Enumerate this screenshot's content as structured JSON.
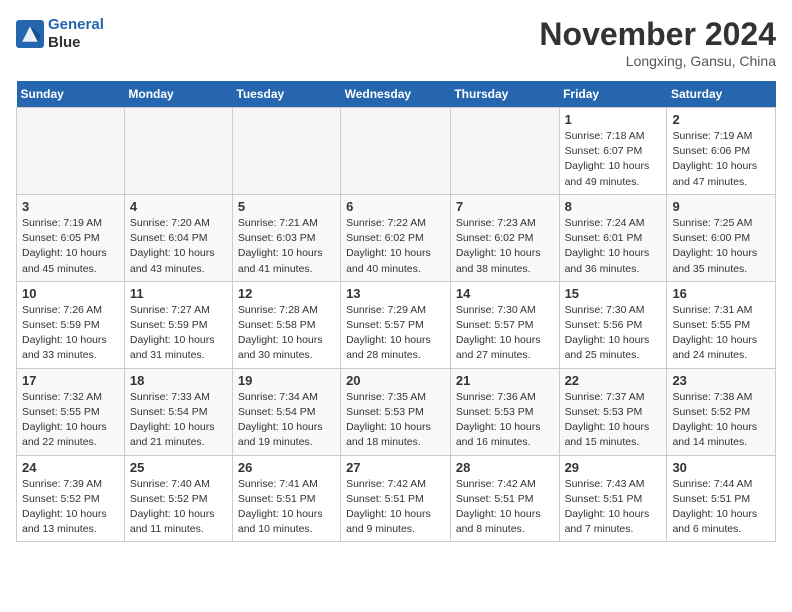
{
  "header": {
    "logo_line1": "General",
    "logo_line2": "Blue",
    "month": "November 2024",
    "location": "Longxing, Gansu, China"
  },
  "weekdays": [
    "Sunday",
    "Monday",
    "Tuesday",
    "Wednesday",
    "Thursday",
    "Friday",
    "Saturday"
  ],
  "weeks": [
    [
      {
        "day": "",
        "info": ""
      },
      {
        "day": "",
        "info": ""
      },
      {
        "day": "",
        "info": ""
      },
      {
        "day": "",
        "info": ""
      },
      {
        "day": "",
        "info": ""
      },
      {
        "day": "1",
        "info": "Sunrise: 7:18 AM\nSunset: 6:07 PM\nDaylight: 10 hours\nand 49 minutes."
      },
      {
        "day": "2",
        "info": "Sunrise: 7:19 AM\nSunset: 6:06 PM\nDaylight: 10 hours\nand 47 minutes."
      }
    ],
    [
      {
        "day": "3",
        "info": "Sunrise: 7:19 AM\nSunset: 6:05 PM\nDaylight: 10 hours\nand 45 minutes."
      },
      {
        "day": "4",
        "info": "Sunrise: 7:20 AM\nSunset: 6:04 PM\nDaylight: 10 hours\nand 43 minutes."
      },
      {
        "day": "5",
        "info": "Sunrise: 7:21 AM\nSunset: 6:03 PM\nDaylight: 10 hours\nand 41 minutes."
      },
      {
        "day": "6",
        "info": "Sunrise: 7:22 AM\nSunset: 6:02 PM\nDaylight: 10 hours\nand 40 minutes."
      },
      {
        "day": "7",
        "info": "Sunrise: 7:23 AM\nSunset: 6:02 PM\nDaylight: 10 hours\nand 38 minutes."
      },
      {
        "day": "8",
        "info": "Sunrise: 7:24 AM\nSunset: 6:01 PM\nDaylight: 10 hours\nand 36 minutes."
      },
      {
        "day": "9",
        "info": "Sunrise: 7:25 AM\nSunset: 6:00 PM\nDaylight: 10 hours\nand 35 minutes."
      }
    ],
    [
      {
        "day": "10",
        "info": "Sunrise: 7:26 AM\nSunset: 5:59 PM\nDaylight: 10 hours\nand 33 minutes."
      },
      {
        "day": "11",
        "info": "Sunrise: 7:27 AM\nSunset: 5:59 PM\nDaylight: 10 hours\nand 31 minutes."
      },
      {
        "day": "12",
        "info": "Sunrise: 7:28 AM\nSunset: 5:58 PM\nDaylight: 10 hours\nand 30 minutes."
      },
      {
        "day": "13",
        "info": "Sunrise: 7:29 AM\nSunset: 5:57 PM\nDaylight: 10 hours\nand 28 minutes."
      },
      {
        "day": "14",
        "info": "Sunrise: 7:30 AM\nSunset: 5:57 PM\nDaylight: 10 hours\nand 27 minutes."
      },
      {
        "day": "15",
        "info": "Sunrise: 7:30 AM\nSunset: 5:56 PM\nDaylight: 10 hours\nand 25 minutes."
      },
      {
        "day": "16",
        "info": "Sunrise: 7:31 AM\nSunset: 5:55 PM\nDaylight: 10 hours\nand 24 minutes."
      }
    ],
    [
      {
        "day": "17",
        "info": "Sunrise: 7:32 AM\nSunset: 5:55 PM\nDaylight: 10 hours\nand 22 minutes."
      },
      {
        "day": "18",
        "info": "Sunrise: 7:33 AM\nSunset: 5:54 PM\nDaylight: 10 hours\nand 21 minutes."
      },
      {
        "day": "19",
        "info": "Sunrise: 7:34 AM\nSunset: 5:54 PM\nDaylight: 10 hours\nand 19 minutes."
      },
      {
        "day": "20",
        "info": "Sunrise: 7:35 AM\nSunset: 5:53 PM\nDaylight: 10 hours\nand 18 minutes."
      },
      {
        "day": "21",
        "info": "Sunrise: 7:36 AM\nSunset: 5:53 PM\nDaylight: 10 hours\nand 16 minutes."
      },
      {
        "day": "22",
        "info": "Sunrise: 7:37 AM\nSunset: 5:53 PM\nDaylight: 10 hours\nand 15 minutes."
      },
      {
        "day": "23",
        "info": "Sunrise: 7:38 AM\nSunset: 5:52 PM\nDaylight: 10 hours\nand 14 minutes."
      }
    ],
    [
      {
        "day": "24",
        "info": "Sunrise: 7:39 AM\nSunset: 5:52 PM\nDaylight: 10 hours\nand 13 minutes."
      },
      {
        "day": "25",
        "info": "Sunrise: 7:40 AM\nSunset: 5:52 PM\nDaylight: 10 hours\nand 11 minutes."
      },
      {
        "day": "26",
        "info": "Sunrise: 7:41 AM\nSunset: 5:51 PM\nDaylight: 10 hours\nand 10 minutes."
      },
      {
        "day": "27",
        "info": "Sunrise: 7:42 AM\nSunset: 5:51 PM\nDaylight: 10 hours\nand 9 minutes."
      },
      {
        "day": "28",
        "info": "Sunrise: 7:42 AM\nSunset: 5:51 PM\nDaylight: 10 hours\nand 8 minutes."
      },
      {
        "day": "29",
        "info": "Sunrise: 7:43 AM\nSunset: 5:51 PM\nDaylight: 10 hours\nand 7 minutes."
      },
      {
        "day": "30",
        "info": "Sunrise: 7:44 AM\nSunset: 5:51 PM\nDaylight: 10 hours\nand 6 minutes."
      }
    ]
  ]
}
